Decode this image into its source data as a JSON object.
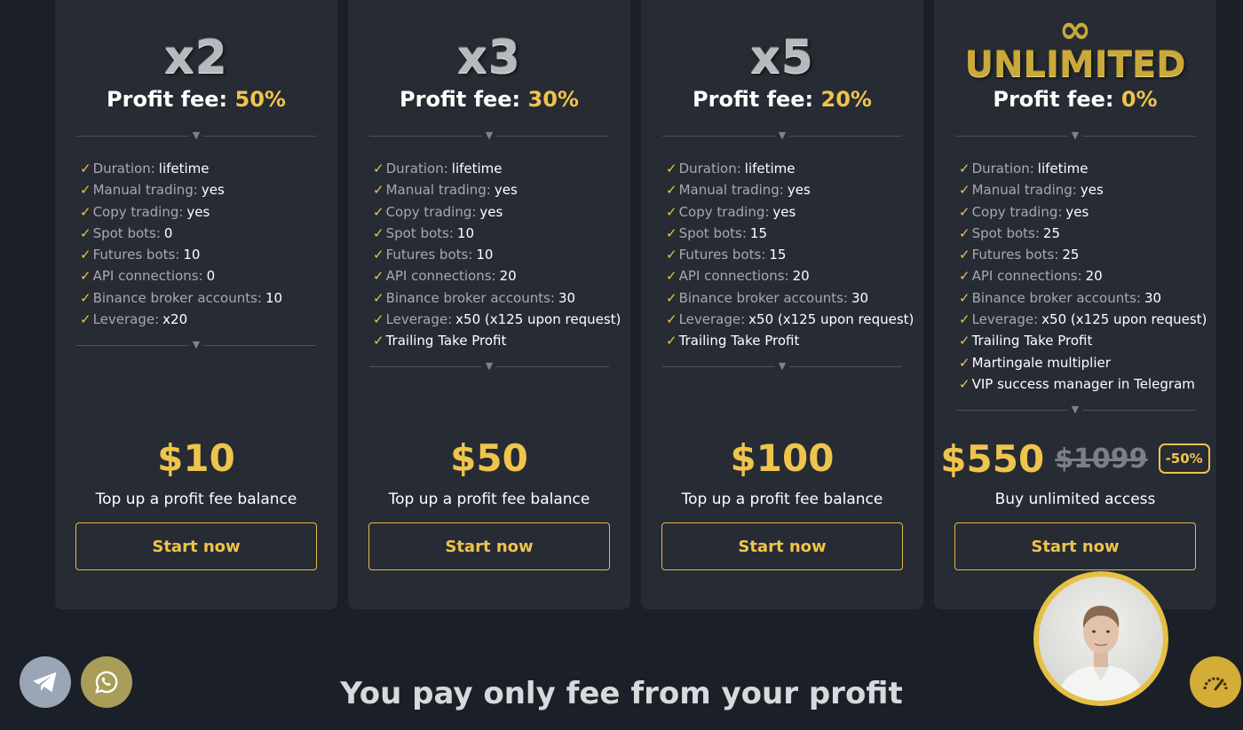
{
  "plans": [
    {
      "multiplier": "x2",
      "fee_label": "Profit fee:",
      "fee_value": "50%",
      "features": [
        {
          "label": "Duration:",
          "value": "lifetime"
        },
        {
          "label": "Manual trading:",
          "value": "yes"
        },
        {
          "label": "Copy trading:",
          "value": "yes"
        },
        {
          "label": "Spot bots:",
          "value": "0"
        },
        {
          "label": "Futures bots:",
          "value": "10"
        },
        {
          "label": "API connections:",
          "value": "0"
        },
        {
          "label": "Binance broker accounts:",
          "value": "10"
        },
        {
          "label": "Leverage:",
          "value": "x20"
        }
      ],
      "extras": [],
      "price": "$10",
      "subtitle": "Top up a profit fee balance",
      "cta": "Start now"
    },
    {
      "multiplier": "x3",
      "fee_label": "Profit fee:",
      "fee_value": "30%",
      "features": [
        {
          "label": "Duration:",
          "value": "lifetime"
        },
        {
          "label": "Manual trading:",
          "value": "yes"
        },
        {
          "label": "Copy trading:",
          "value": "yes"
        },
        {
          "label": "Spot bots:",
          "value": "10"
        },
        {
          "label": "Futures bots:",
          "value": "10"
        },
        {
          "label": "API connections:",
          "value": "20"
        },
        {
          "label": "Binance broker accounts:",
          "value": "30"
        },
        {
          "label": "Leverage:",
          "value": "x50 (x125 upon request)"
        }
      ],
      "extras": [
        "Trailing Take Profit"
      ],
      "price": "$50",
      "subtitle": "Top up a profit fee balance",
      "cta": "Start now"
    },
    {
      "multiplier": "x5",
      "fee_label": "Profit fee:",
      "fee_value": "20%",
      "features": [
        {
          "label": "Duration:",
          "value": "lifetime"
        },
        {
          "label": "Manual trading:",
          "value": "yes"
        },
        {
          "label": "Copy trading:",
          "value": "yes"
        },
        {
          "label": "Spot bots:",
          "value": "15"
        },
        {
          "label": "Futures bots:",
          "value": "15"
        },
        {
          "label": "API connections:",
          "value": "20"
        },
        {
          "label": "Binance broker accounts:",
          "value": "30"
        },
        {
          "label": "Leverage:",
          "value": "x50 (x125 upon request)"
        }
      ],
      "extras": [
        "Trailing Take Profit"
      ],
      "price": "$100",
      "subtitle": "Top up a profit fee balance",
      "cta": "Start now"
    },
    {
      "multiplier": "UNLIMITED",
      "fee_label": "Profit fee:",
      "fee_value": "0%",
      "features": [
        {
          "label": "Duration:",
          "value": "lifetime"
        },
        {
          "label": "Manual trading:",
          "value": "yes"
        },
        {
          "label": "Copy trading:",
          "value": "yes"
        },
        {
          "label": "Spot bots:",
          "value": "25"
        },
        {
          "label": "Futures bots:",
          "value": "25"
        },
        {
          "label": "API connections:",
          "value": "20"
        },
        {
          "label": "Binance broker accounts:",
          "value": "30"
        },
        {
          "label": "Leverage:",
          "value": "x50 (x125 upon request)"
        }
      ],
      "extras": [
        "Trailing Take Profit",
        "Martingale multiplier",
        "VIP success manager in Telegram"
      ],
      "price": "$550",
      "old_price": "$1099",
      "discount": "-50%",
      "subtitle": "Buy unlimited access",
      "cta": "Start now"
    }
  ],
  "headline": "You pay only fee from your profit",
  "icons": {
    "check": "✓",
    "divider_arrow": "▼",
    "infinity": "∞",
    "telegram": "telegram-icon",
    "whatsapp": "whatsapp-icon",
    "speed": "speedometer-icon"
  },
  "colors": {
    "background": "#1b1f27",
    "card": "#272b33",
    "accent_gold": "#eec44c",
    "muted_text": "#a7a9ae"
  }
}
